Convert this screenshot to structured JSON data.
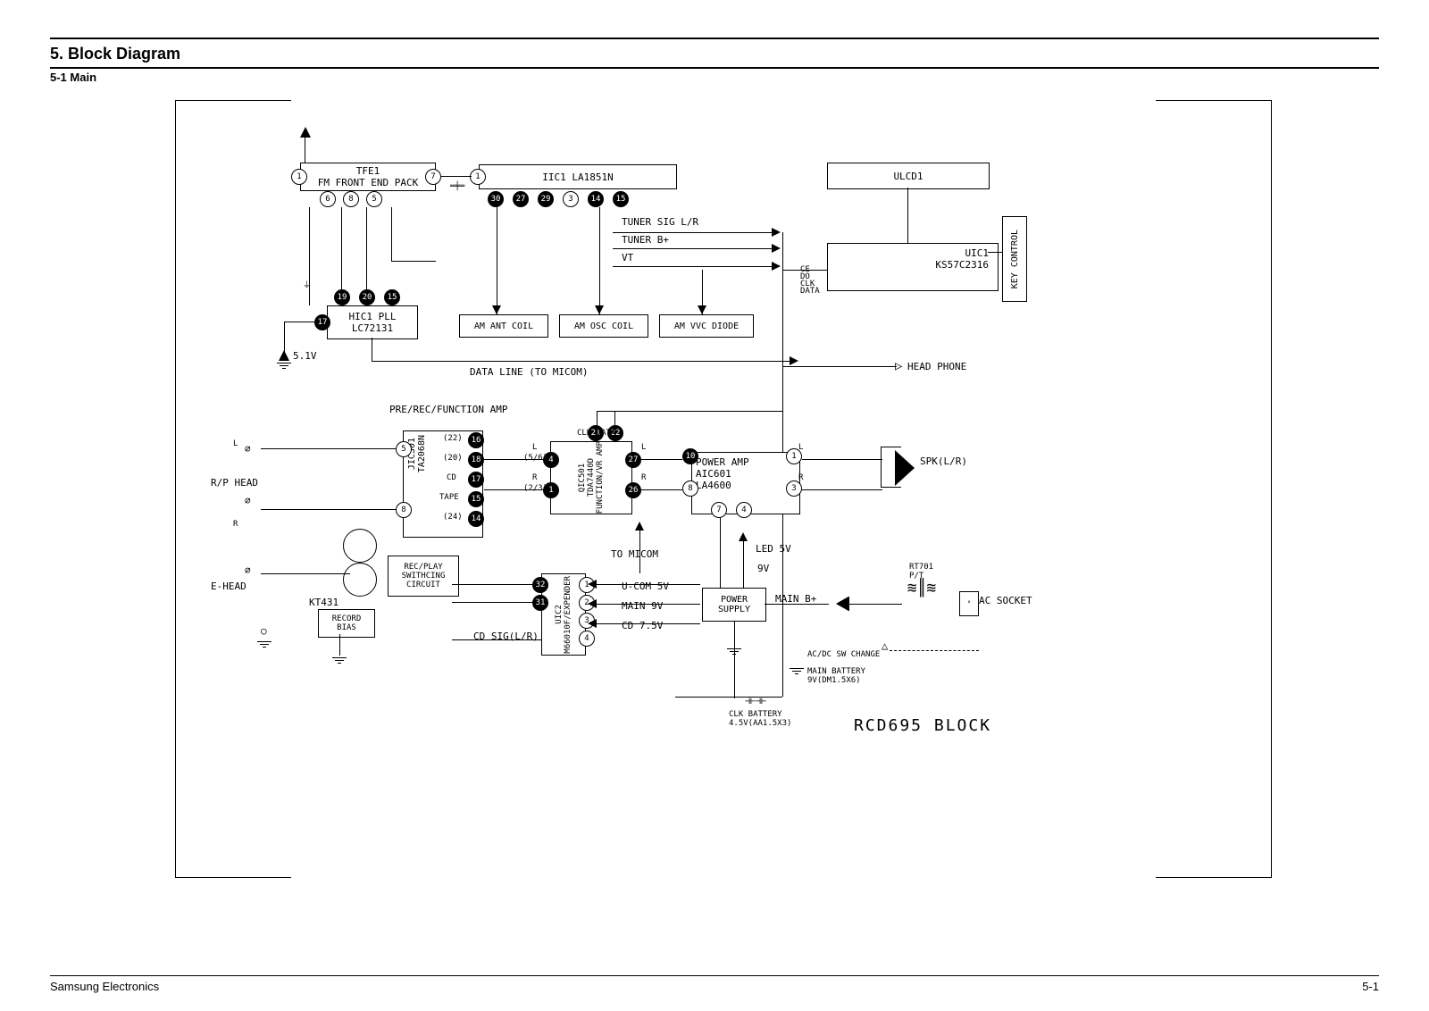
{
  "header": {
    "section_title": "5. Block Diagram",
    "sub_title": "5-1 Main"
  },
  "diagram_title": "RCD695 BLOCK",
  "blocks": {
    "tfe1": "TFE1\nFM FRONT END PACK",
    "iic1": "IIC1 LA1851N",
    "hic1": "HIC1 PLL\nLC72131",
    "am_ant_coil": "AM ANT COIL",
    "am_osc_coil": "AM OSC COIL",
    "am_vvc_diode": "AM VVC DIODE",
    "ulcd1": "ULCD1",
    "uic1": "UIC1\nKS57C2316",
    "jic301": "JIC301\nTA2068N",
    "qic501": "QIC501\nTDA7440D\nFUNCTION/VR AMP",
    "aic601": "POWER AMP\nAIC601\nLA4600",
    "uic2": "UIC2\nM66010F/EXPENDER",
    "rec_play": "REC/PLAY\nSWITHCING\nCIRCUIT",
    "record_bias": "RECORD\nBIAS",
    "power_supply": "POWER\nSUPPLY",
    "rt701": "RT701\nP/T"
  },
  "signals": {
    "tuner_sig": "TUNER SIG L/R",
    "tuner_b": "TUNER B+",
    "vt": "VT",
    "ce_do_clk_data": "CE\nDO\nCLK\nDATA",
    "five_one_v": "5.1V",
    "data_line": "DATA LINE (TO MICOM)",
    "pre_rec_function": "PRE/REC/FUNCTION AMP",
    "clk_data": "CLK DATA",
    "pin22": "(22)",
    "pin20": "(20)",
    "pin24": "(24)",
    "cd": "CD",
    "tape": "TAPE",
    "pin_5_6": "(5/6)",
    "pin_2_3": "(2/3)",
    "rp_head": "R/P HEAD",
    "e_head": "E-HEAD",
    "kt431": "KT431",
    "to_micom": "TO MICOM",
    "cd_sig": "CD SIG(L/R)",
    "ucom_5v": "U-COM 5V",
    "main_9v": "MAIN 9V",
    "cd_7_5v": "CD 7.5V",
    "nine_v": "9V",
    "led_5v": "LED 5V",
    "main_b_plus": "MAIN B+",
    "ac_socket": "AC SOCKET",
    "acdc_sw": "AC/DC SW CHANGE",
    "main_battery": "MAIN BATTERY\n9V(DM1.5X6)",
    "clk_battery": "CLK BATTERY\n4.5V(AA1.5X3)",
    "head_phone": "HEAD PHONE",
    "spk_lr": "SPK(L/R)",
    "key_control": "KEY CONTROL",
    "left": "L",
    "right": "R"
  },
  "pins_tfe1": [
    "1",
    "7",
    "6",
    "8",
    "5"
  ],
  "pins_iic1": [
    "1",
    "30",
    "27",
    "29",
    "3",
    "14",
    "15"
  ],
  "pins_hic1_upper": [
    "19",
    "20",
    "15"
  ],
  "pins_hic1_left": "17",
  "pins_jic301": [
    "5",
    "16",
    "18",
    "17",
    "15",
    "14",
    "8"
  ],
  "pins_qic501_left": [
    "4",
    "1"
  ],
  "pins_qic501_right": [
    "21",
    "22",
    "27",
    "26"
  ],
  "pins_aic601": [
    "10",
    "8",
    "1",
    "3",
    "7",
    "4"
  ],
  "pins_uic2": [
    "32",
    "31",
    "1",
    "2",
    "3",
    "4"
  ],
  "footer": {
    "company": "Samsung Electronics",
    "page": "5-1"
  }
}
